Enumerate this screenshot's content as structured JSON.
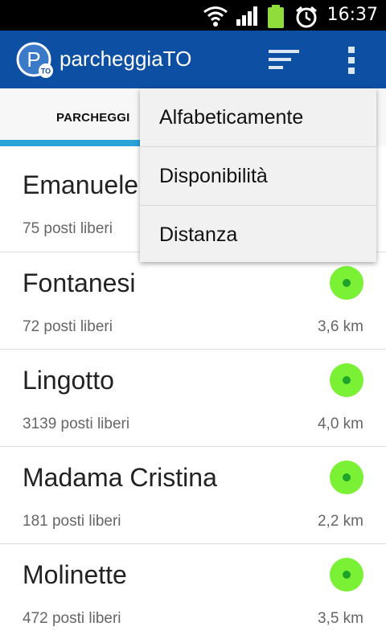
{
  "status_bar": {
    "time": "16:37",
    "icons": [
      "wifi-icon",
      "signal-icon",
      "battery-icon",
      "alarm-icon"
    ]
  },
  "app_bar": {
    "title": "parcheggiaTO",
    "logo_letter": "P",
    "logo_badge": "TO",
    "icons": [
      "sort-icon",
      "overflow-menu-icon"
    ]
  },
  "tabs": [
    {
      "label": "PARCHEGGI",
      "selected": true
    }
  ],
  "sort_menu": {
    "items": [
      {
        "label": "Alfabeticamente"
      },
      {
        "label": "Disponibilità"
      },
      {
        "label": "Distanza"
      }
    ]
  },
  "parkings": [
    {
      "name": "Emanuele",
      "free": "75 posti liberi",
      "distance": ""
    },
    {
      "name": "Fontanesi",
      "free": "72 posti liberi",
      "distance": "3,6 km"
    },
    {
      "name": "Lingotto",
      "free": "3139 posti liberi",
      "distance": "4,0 km"
    },
    {
      "name": "Madama Cristina",
      "free": "181 posti liberi",
      "distance": "2,2 km"
    },
    {
      "name": "Molinette",
      "free": "472 posti liberi",
      "distance": "3,5 km"
    }
  ],
  "colors": {
    "app_bar": "#0d4fa3",
    "tab_indicator": "#2aa3d8",
    "status_available": "#7bf135"
  }
}
